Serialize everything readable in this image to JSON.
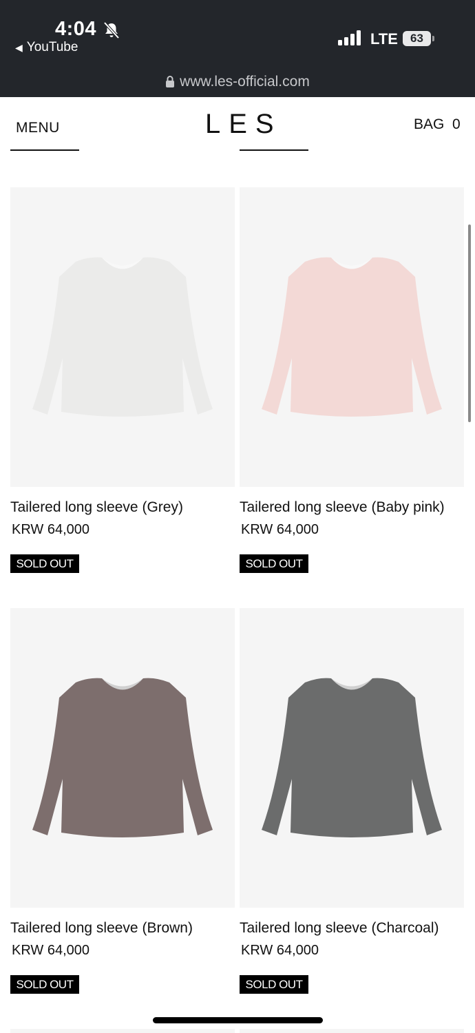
{
  "status_bar": {
    "time": "4:04",
    "back_app": "YouTube",
    "network": "LTE",
    "battery": "63"
  },
  "browser": {
    "url": "www.les-official.com"
  },
  "header": {
    "menu_label": "MENU",
    "logo": "LES",
    "bag_label": "BAG",
    "bag_count": "0"
  },
  "products": [
    {
      "name": "Tailered long sleeve (Grey)",
      "price": "KRW 64,000",
      "badge": "SOLD OUT",
      "color": "#ebebea"
    },
    {
      "name": "Tailered long sleeve (Baby pink)",
      "price": "KRW 64,000",
      "badge": "SOLD OUT",
      "color": "#f3d9d6"
    },
    {
      "name": "Tailered long sleeve (Brown)",
      "price": "KRW 64,000",
      "badge": "SOLD OUT",
      "color": "#7d6e6d"
    },
    {
      "name": "Tailered long sleeve (Charcoal)",
      "price": "KRW 64,000",
      "badge": "SOLD OUT",
      "color": "#6b6c6c"
    }
  ],
  "icons": {
    "bell_off": "bell-slash-icon",
    "lock": "lock-icon",
    "signal": "cellular-signal-icon",
    "back": "back-triangle-icon"
  }
}
